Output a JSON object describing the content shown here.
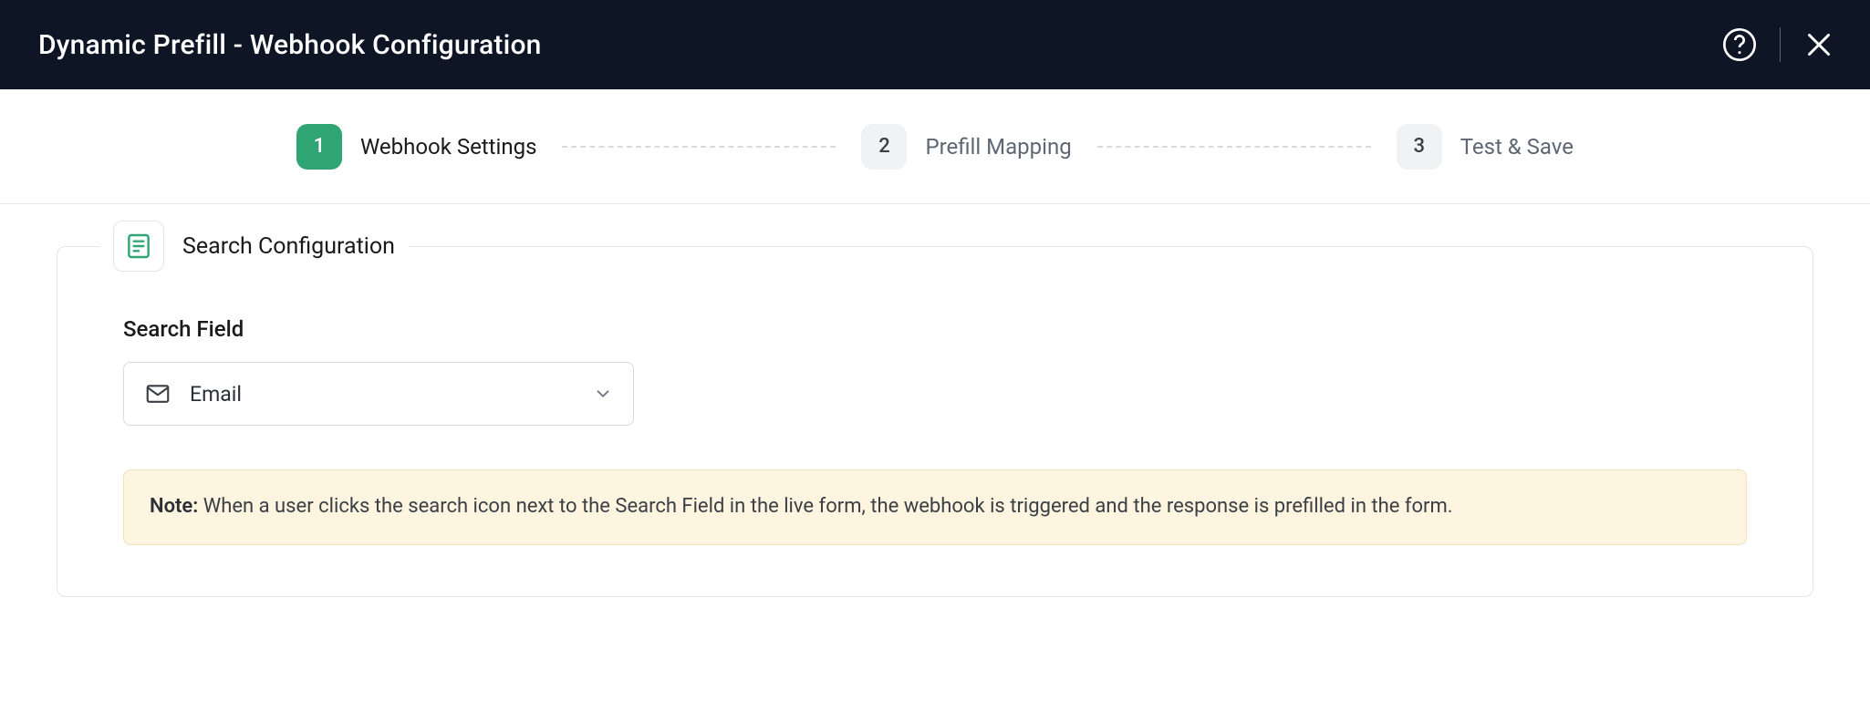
{
  "header": {
    "title": "Dynamic Prefill - Webhook Configuration"
  },
  "stepper": {
    "steps": [
      {
        "num": "1",
        "label": "Webhook Settings",
        "active": true
      },
      {
        "num": "2",
        "label": "Prefill Mapping",
        "active": false
      },
      {
        "num": "3",
        "label": "Test & Save",
        "active": false
      }
    ]
  },
  "panel": {
    "legend_title": "Search Configuration",
    "field_label": "Search Field",
    "select_value": "Email",
    "note_prefix": "Note:",
    "note_text": " When a user clicks the search icon next to the Search Field in the live form, the webhook is triggered and the response is prefilled in the form."
  },
  "icons": {
    "help": "help-circle-icon",
    "close": "close-icon",
    "form": "form-icon",
    "mail": "mail-icon",
    "chevron": "chevron-down-icon"
  }
}
